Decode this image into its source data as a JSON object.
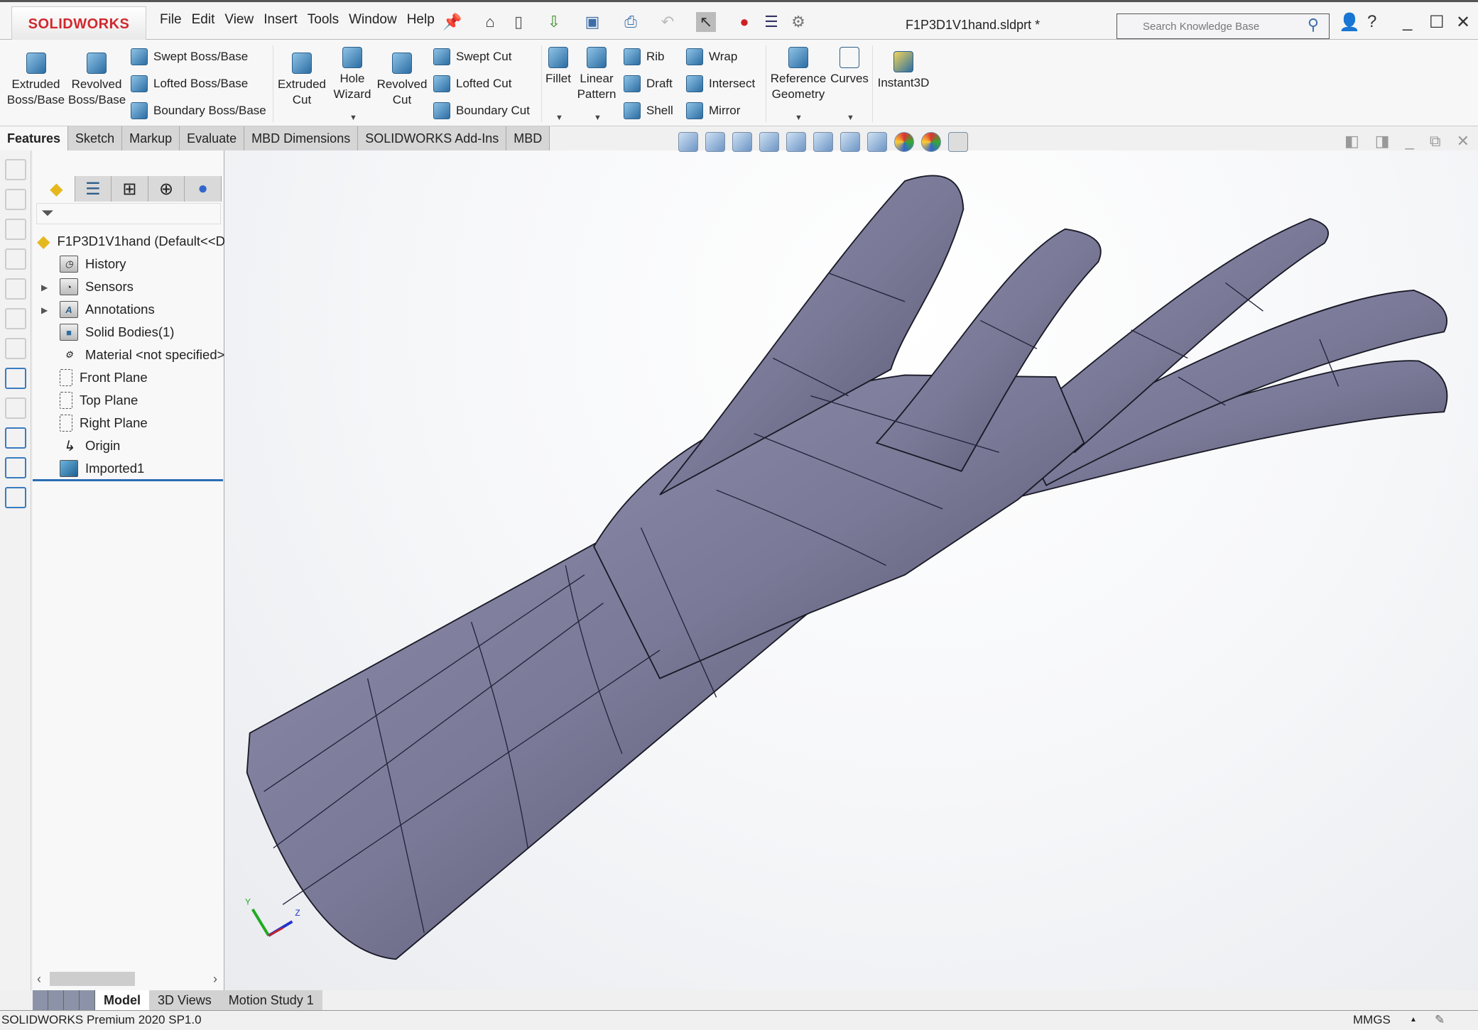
{
  "app": {
    "logo": "SOLIDWORKS",
    "title": "F1P3D1V1hand.sldprt *"
  },
  "menu": [
    "File",
    "Edit",
    "View",
    "Insert",
    "Tools",
    "Window",
    "Help"
  ],
  "search": {
    "placeholder": "Search Knowledge Base"
  },
  "ribbon": {
    "extruded_boss": "Extruded Boss/Base",
    "revolved_boss": "Revolved Boss/Base",
    "swept_boss": "Swept Boss/Base",
    "lofted_boss": "Lofted Boss/Base",
    "boundary_boss": "Boundary Boss/Base",
    "extruded_cut": "Extruded Cut",
    "hole_wizard": "Hole Wizard",
    "revolved_cut": "Revolved Cut",
    "swept_cut": "Swept Cut",
    "lofted_cut": "Lofted Cut",
    "boundary_cut": "Boundary Cut",
    "fillet": "Fillet",
    "linear_pattern": "Linear Pattern",
    "rib": "Rib",
    "draft": "Draft",
    "shell": "Shell",
    "wrap": "Wrap",
    "intersect": "Intersect",
    "mirror": "Mirror",
    "reference_geometry": "Reference Geometry",
    "curves": "Curves",
    "instant3d": "Instant3D"
  },
  "tabs": [
    "Features",
    "Sketch",
    "Markup",
    "Evaluate",
    "MBD Dimensions",
    "SOLIDWORKS Add-Ins",
    "MBD"
  ],
  "tree": {
    "root": "F1P3D1V1hand  (Default<<D",
    "items": [
      "History",
      "Sensors",
      "Annotations",
      "Solid Bodies(1)",
      "Material <not specified>",
      "Front Plane",
      "Top Plane",
      "Right Plane",
      "Origin",
      "Imported1"
    ]
  },
  "bottom_tabs": [
    "Model",
    "3D Views",
    "Motion Study 1"
  ],
  "status": {
    "left": "SOLIDWORKS Premium 2020 SP1.0",
    "units": "MMGS"
  },
  "triad": {
    "y": "Y",
    "z": "Z"
  },
  "colors": {
    "model": "#7a7a98",
    "accent": "#2a6db3",
    "logo": "#d0282e"
  }
}
